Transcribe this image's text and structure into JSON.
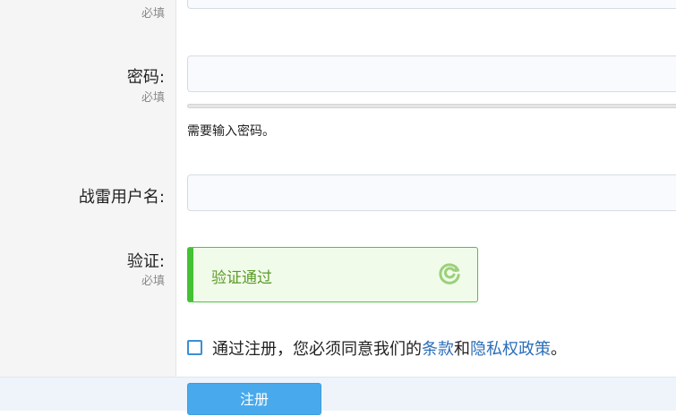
{
  "form": {
    "required_text": "必填",
    "password": {
      "label": "密码:",
      "required": "必填",
      "value": "",
      "hint": "需要输入密码。"
    },
    "warthunder_username": {
      "label": "战雷用户名:",
      "value": ""
    },
    "verification": {
      "label": "验证:",
      "required": "必填",
      "status": "验证通过"
    },
    "agreement": {
      "prefix": "通过注册，您必须同意我们的",
      "terms_link": "条款",
      "and": "和",
      "privacy_link": "隐私权政策",
      "suffix": "。",
      "checked": false
    },
    "submit_label": "注册"
  },
  "colors": {
    "link": "#2a6eb8",
    "success": "#43c233",
    "primary_button": "#48a9ec"
  },
  "icons": {
    "captcha": "captcha-refresh-icon"
  }
}
